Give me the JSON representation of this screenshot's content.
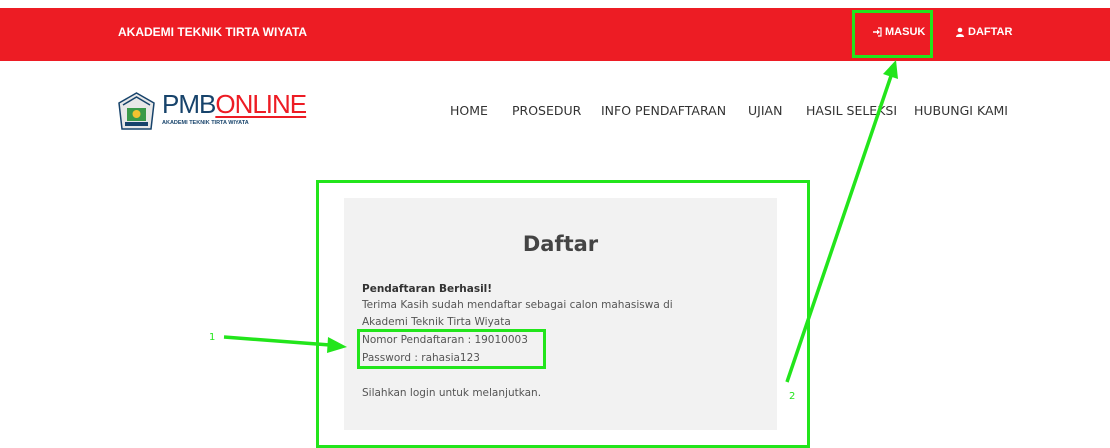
{
  "topbar": {
    "brand": "AKADEMI TEKNIK TIRTA WIYATA",
    "login_label": "MASUK",
    "register_label": "DAFTAR",
    "color": "#ed1c24"
  },
  "logo": {
    "title_part1": "PMB",
    "title_part2": "ONLINE",
    "subtitle": "AKADEMI TEKNIK TIRTA WIYATA"
  },
  "nav": {
    "items": [
      "HOME",
      "PROSEDUR",
      "INFO PENDAFTARAN",
      "UJIAN",
      "HASIL SELEKSI",
      "HUBUNGI KAMI"
    ]
  },
  "panel": {
    "title": "Daftar",
    "success_heading": "Pendaftaran Berhasil!",
    "line1": "Terima Kasih sudah mendaftar sebagai calon mahasiswa di",
    "line2": "Akademi Teknik Tirta Wiyata",
    "reg_number": "Nomor Pendaftaran : 19010003",
    "password": "Password : rahasia123",
    "instruction": "Silahkan login untuk melanjutkan."
  },
  "annotations": {
    "label1": "1",
    "label2": "2",
    "color": "#22e51b"
  }
}
